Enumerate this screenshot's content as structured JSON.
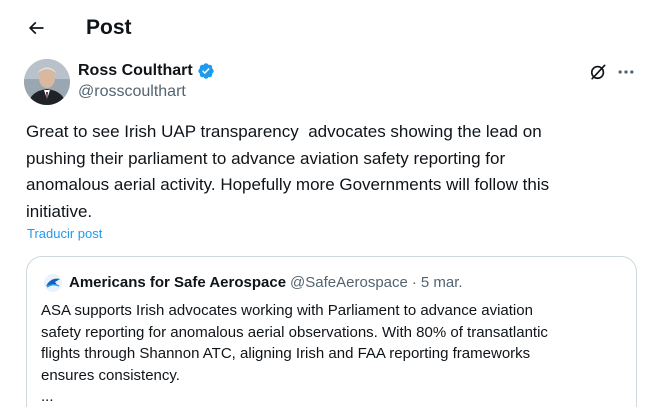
{
  "header": {
    "title": "Post"
  },
  "author": {
    "name": "Ross Coulthart",
    "handle": "@rosscoulthart",
    "verified": true
  },
  "post": {
    "text": "Great to see Irish UAP transparency  advocates showing the lead on\npushing their parliament to advance aviation safety reporting for\nanomalous aerial activity. Hopefully more Governments will follow this\ninitiative.",
    "translate_label": "Traducir post"
  },
  "quote": {
    "name": "Americans for Safe Aerospace",
    "handle": "@SafeAerospace",
    "separator": "·",
    "time": "5 mar.",
    "text": "ASA supports Irish advocates working with Parliament to advance aviation\nsafety reporting for anomalous aerial observations. With 80% of transatlantic\nflights through Shannon ATC, aligning Irish and FAA reporting frameworks\nensures consistency.",
    "ellipsis": "..."
  },
  "icons": {
    "back": "arrow-left-icon",
    "verified": "verified-badge-icon",
    "grok": "grok-icon",
    "more": "more-horizontal-icon",
    "quote_avatar": "asa-logo-icon"
  },
  "colors": {
    "accent": "#1d9bf0",
    "text": "#0f1419",
    "secondary": "#536471",
    "border": "#cfd9de"
  }
}
